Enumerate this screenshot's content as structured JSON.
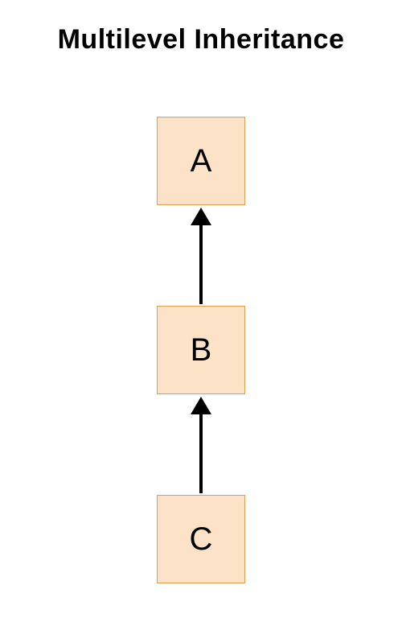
{
  "title": "Multilevel Inheritance",
  "nodes": {
    "a": "A",
    "b": "B",
    "c": "C"
  },
  "colors": {
    "nodeFill": "#fce3c7",
    "nodeBorder": "#e0a050",
    "arrow": "#000000"
  },
  "chart_data": {
    "type": "diagram",
    "title": "Multilevel Inheritance",
    "nodes": [
      "A",
      "B",
      "C"
    ],
    "edges": [
      {
        "from": "B",
        "to": "A"
      },
      {
        "from": "C",
        "to": "B"
      }
    ],
    "direction": "arrow points from child to parent"
  }
}
